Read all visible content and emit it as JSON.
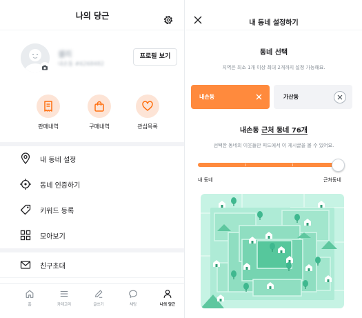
{
  "left": {
    "header": {
      "title": "나의 당근",
      "settings_icon": "gear-icon"
    },
    "profile": {
      "nickname": "셀리",
      "user_id": "내손동 #6268482",
      "profile_button": "프로필 보기"
    },
    "quick_actions": [
      {
        "label": "판매내역",
        "icon": "receipt-icon"
      },
      {
        "label": "구매내역",
        "icon": "shopping-bag-icon"
      },
      {
        "label": "관심목록",
        "icon": "heart-icon"
      }
    ],
    "menu": [
      {
        "label": "내 동네 설정",
        "icon": "location-pin-icon"
      },
      {
        "label": "동네 인증하기",
        "icon": "target-icon"
      },
      {
        "label": "키워드 등록",
        "icon": "tag-icon"
      },
      {
        "label": "모아보기",
        "icon": "grid-icon"
      },
      {
        "label": "친구초대",
        "icon": "envelope-icon"
      }
    ],
    "tabbar": [
      {
        "label": "홈",
        "icon": "home-icon",
        "active": false
      },
      {
        "label": "카테고리",
        "icon": "menu-icon",
        "active": false
      },
      {
        "label": "글쓰기",
        "icon": "pencil-icon",
        "active": false
      },
      {
        "label": "채팅",
        "icon": "chat-icon",
        "active": false
      },
      {
        "label": "나의 당근",
        "icon": "person-icon",
        "active": true
      }
    ]
  },
  "right": {
    "header": {
      "title": "내 동네 설정하기",
      "close_icon": "close-icon"
    },
    "selection": {
      "title": "동네 선택",
      "description": "지역은 최소 1개 이상 최대 2개까지 설정 가능해요.",
      "neighborhoods": [
        {
          "name": "내손동",
          "selected": true
        },
        {
          "name": "가산동",
          "selected": false
        }
      ]
    },
    "range": {
      "prefix": "내손동",
      "count_text": "근처 동네 76개",
      "description": "선택한 동네의 이웃들만 피드에서 이 게시글을 볼 수 있어요.",
      "min_label": "내 동네",
      "max_label": "근처동네",
      "slider_level": 1.0,
      "steps": 4
    }
  },
  "colors": {
    "accent": "#ff8a3d",
    "accent_light": "#fde4d6",
    "text": "#212124",
    "muted": "#868e96",
    "map_mint": "#c6f3e4",
    "map_green": "#3fb88f"
  }
}
